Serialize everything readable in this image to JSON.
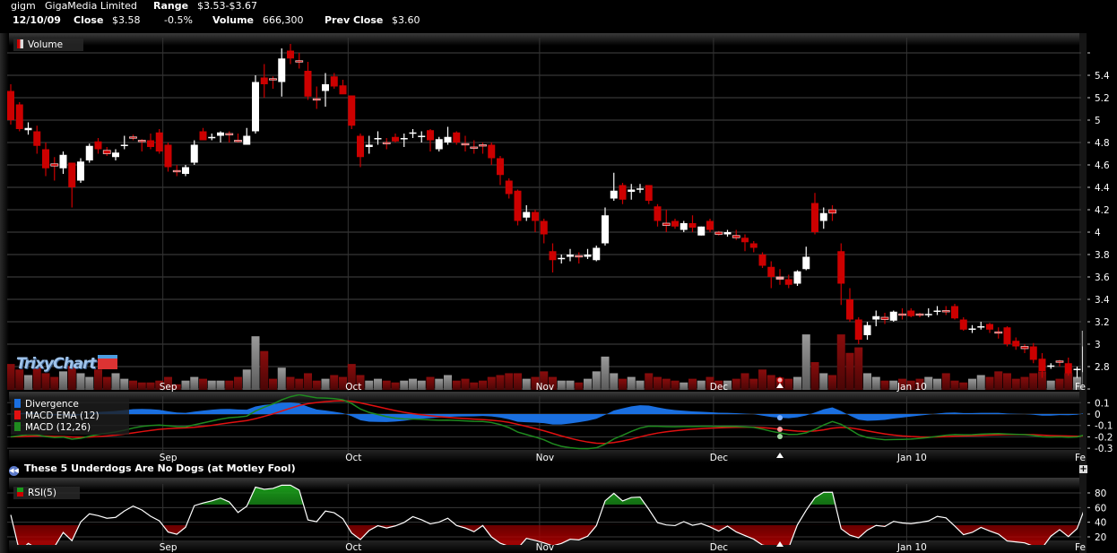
{
  "header": {
    "symbol": "gigm",
    "company": "GigaMedia Limited",
    "range_label": "Range",
    "range_value": "$3.53-$3.67",
    "date": "12/10/09",
    "close_label": "Close",
    "close_value": "$3.58",
    "change": "-0.5%",
    "volume_label": "Volume",
    "volume_value": "666,300",
    "prev_close_label": "Prev Close",
    "prev_close_value": "$3.60"
  },
  "legends": {
    "volume": "Volume",
    "divergence": "Divergence",
    "macd_ema": "MACD EMA (12)",
    "macd": "MACD (12,26)",
    "rsi": "RSI(5)"
  },
  "logo": "TrixyChart",
  "news": {
    "icon": "rewind-icon",
    "icon_glyph": "◀◀",
    "headline": "These 5 Underdogs Are No Dogs (at Motley Fool)"
  },
  "expand_button": "+",
  "colors": {
    "up": "#ffffff",
    "down": "#cc0000",
    "vol_up": "#8a8a8a",
    "vol_down": "#6e0a0a",
    "divergence": "#1a6fe0",
    "macd_ema": "#e01010",
    "macd": "#1f8a1f",
    "rsi": "#ffffff"
  },
  "chart_data": [
    {
      "type": "candlestick",
      "title": "gigm price",
      "selected_index": 88,
      "x_labels": [
        {
          "label": "Sep",
          "index": 17.4
        },
        {
          "label": "Oct",
          "index": 38.6
        },
        {
          "label": "Nov",
          "index": 60.5
        },
        {
          "label": "Dec",
          "index": 80.4
        },
        {
          "label": "Jan 10",
          "index": 102.5
        },
        {
          "label": "Fe",
          "index": 122.6
        }
      ],
      "y_ticks": [
        "2.8",
        "3",
        "3.2",
        "3.4",
        "3.6",
        "3.8",
        "4",
        "4.2",
        "4.4",
        "4.6",
        "4.8",
        "5",
        "5.2",
        "5.4"
      ],
      "ylim": [
        2.6,
        5.6
      ],
      "ohlc": [
        [
          5.26,
          5.32,
          4.96,
          5.0
        ],
        [
          5.14,
          5.16,
          4.9,
          4.92
        ],
        [
          4.91,
          4.98,
          4.87,
          4.93
        ],
        [
          4.9,
          4.95,
          4.7,
          4.77
        ],
        [
          4.74,
          4.8,
          4.5,
          4.57
        ],
        [
          4.61,
          4.67,
          4.46,
          4.59
        ],
        [
          4.57,
          4.72,
          4.52,
          4.69
        ],
        [
          4.62,
          4.62,
          4.22,
          4.4
        ],
        [
          4.46,
          4.66,
          4.44,
          4.63
        ],
        [
          4.64,
          4.79,
          4.62,
          4.77
        ],
        [
          4.81,
          4.84,
          4.7,
          4.74
        ],
        [
          4.73,
          4.76,
          4.68,
          4.7
        ],
        [
          4.67,
          4.74,
          4.64,
          4.71
        ],
        [
          4.77,
          4.86,
          4.74,
          4.78
        ],
        [
          4.85,
          4.87,
          4.82,
          4.84
        ],
        [
          4.82,
          4.83,
          4.72,
          4.81
        ],
        [
          4.82,
          4.88,
          4.74,
          4.76
        ],
        [
          4.89,
          4.92,
          4.7,
          4.72
        ],
        [
          4.78,
          4.8,
          4.54,
          4.58
        ],
        [
          4.55,
          4.6,
          4.5,
          4.54
        ],
        [
          4.52,
          4.6,
          4.5,
          4.58
        ],
        [
          4.62,
          4.82,
          4.6,
          4.78
        ],
        [
          4.9,
          4.93,
          4.82,
          4.82
        ],
        [
          4.85,
          4.88,
          4.82,
          4.85
        ],
        [
          4.86,
          4.9,
          4.8,
          4.89
        ],
        [
          4.88,
          4.9,
          4.8,
          4.87
        ],
        [
          4.82,
          4.88,
          4.8,
          4.81
        ],
        [
          4.78,
          4.93,
          4.78,
          4.86
        ],
        [
          4.9,
          5.4,
          4.88,
          5.34
        ],
        [
          5.38,
          5.5,
          5.2,
          5.32
        ],
        [
          5.37,
          5.39,
          5.28,
          5.36
        ],
        [
          5.34,
          5.64,
          5.21,
          5.55
        ],
        [
          5.62,
          5.68,
          5.5,
          5.55
        ],
        [
          5.53,
          5.6,
          5.46,
          5.52
        ],
        [
          5.44,
          5.52,
          5.18,
          5.21
        ],
        [
          5.19,
          5.3,
          5.1,
          5.18
        ],
        [
          5.26,
          5.42,
          5.12,
          5.32
        ],
        [
          5.39,
          5.42,
          5.28,
          5.3
        ],
        [
          5.31,
          5.36,
          5.25,
          5.23
        ],
        [
          5.22,
          5.22,
          4.92,
          4.95
        ],
        [
          4.86,
          4.88,
          4.58,
          4.67
        ],
        [
          4.76,
          4.86,
          4.7,
          4.78
        ],
        [
          4.83,
          4.9,
          4.78,
          4.84
        ],
        [
          4.8,
          4.84,
          4.74,
          4.79
        ],
        [
          4.85,
          4.88,
          4.8,
          4.81
        ],
        [
          4.84,
          4.88,
          4.76,
          4.84
        ],
        [
          4.88,
          4.92,
          4.84,
          4.89
        ],
        [
          4.86,
          4.9,
          4.8,
          4.86
        ],
        [
          4.91,
          4.92,
          4.72,
          4.82
        ],
        [
          4.74,
          4.85,
          4.72,
          4.83
        ],
        [
          4.8,
          4.94,
          4.78,
          4.85
        ],
        [
          4.89,
          4.9,
          4.78,
          4.8
        ],
        [
          4.79,
          4.86,
          4.72,
          4.78
        ],
        [
          4.76,
          4.82,
          4.7,
          4.75
        ],
        [
          4.78,
          4.8,
          4.7,
          4.77
        ],
        [
          4.78,
          4.8,
          4.6,
          4.66
        ],
        [
          4.66,
          4.68,
          4.42,
          4.51
        ],
        [
          4.46,
          4.48,
          4.3,
          4.34
        ],
        [
          4.37,
          4.38,
          4.06,
          4.1
        ],
        [
          4.13,
          4.24,
          4.1,
          4.18
        ],
        [
          4.18,
          4.2,
          4.0,
          4.1
        ],
        [
          4.1,
          4.12,
          3.9,
          3.98
        ],
        [
          3.83,
          3.9,
          3.64,
          3.75
        ],
        [
          3.76,
          3.8,
          3.72,
          3.77
        ],
        [
          3.78,
          3.85,
          3.74,
          3.8
        ],
        [
          3.79,
          3.82,
          3.72,
          3.78
        ],
        [
          3.78,
          3.85,
          3.76,
          3.8
        ],
        [
          3.75,
          3.88,
          3.74,
          3.86
        ],
        [
          3.9,
          4.22,
          3.88,
          4.15
        ],
        [
          4.3,
          4.53,
          4.28,
          4.37
        ],
        [
          4.42,
          4.44,
          4.25,
          4.29
        ],
        [
          4.36,
          4.43,
          4.29,
          4.38
        ],
        [
          4.38,
          4.43,
          4.35,
          4.39
        ],
        [
          4.42,
          4.42,
          4.25,
          4.28
        ],
        [
          4.23,
          4.25,
          4.05,
          4.1
        ],
        [
          4.08,
          4.2,
          4.0,
          4.06
        ],
        [
          4.1,
          4.12,
          4.03,
          4.05
        ],
        [
          4.02,
          4.1,
          4.0,
          4.08
        ],
        [
          4.08,
          4.15,
          4.0,
          4.04
        ],
        [
          3.97,
          4.05,
          3.97,
          4.05
        ],
        [
          4.1,
          4.12,
          4.0,
          4.02
        ],
        [
          4.0,
          4.01,
          3.97,
          3.98
        ],
        [
          3.98,
          4.02,
          3.96,
          4.0
        ],
        [
          3.97,
          4.02,
          3.93,
          3.95
        ],
        [
          3.95,
          3.98,
          3.83,
          3.91
        ],
        [
          3.9,
          3.92,
          3.82,
          3.86
        ],
        [
          3.8,
          3.82,
          3.68,
          3.7
        ],
        [
          3.69,
          3.74,
          3.5,
          3.6
        ],
        [
          3.6,
          3.67,
          3.53,
          3.58
        ],
        [
          3.58,
          3.62,
          3.5,
          3.53
        ],
        [
          3.54,
          3.66,
          3.52,
          3.65
        ],
        [
          3.67,
          3.87,
          3.66,
          3.78
        ],
        [
          4.26,
          4.35,
          3.98,
          4.0
        ],
        [
          4.1,
          4.22,
          4.03,
          4.17
        ],
        [
          4.2,
          4.24,
          4.1,
          4.17
        ],
        [
          3.83,
          3.9,
          3.35,
          3.54
        ],
        [
          3.4,
          3.5,
          3.2,
          3.22
        ],
        [
          3.22,
          3.24,
          3.0,
          3.04
        ],
        [
          3.08,
          3.2,
          3.04,
          3.17
        ],
        [
          3.22,
          3.3,
          3.16,
          3.25
        ],
        [
          3.24,
          3.28,
          3.18,
          3.22
        ],
        [
          3.21,
          3.3,
          3.2,
          3.29
        ],
        [
          3.27,
          3.32,
          3.22,
          3.26
        ],
        [
          3.3,
          3.32,
          3.24,
          3.25
        ],
        [
          3.27,
          3.28,
          3.24,
          3.26
        ],
        [
          3.26,
          3.32,
          3.24,
          3.27
        ],
        [
          3.29,
          3.34,
          3.26,
          3.3
        ],
        [
          3.3,
          3.34,
          3.26,
          3.29
        ],
        [
          3.34,
          3.36,
          3.22,
          3.23
        ],
        [
          3.22,
          3.24,
          3.12,
          3.13
        ],
        [
          3.13,
          3.17,
          3.1,
          3.14
        ],
        [
          3.15,
          3.2,
          3.13,
          3.16
        ],
        [
          3.18,
          3.19,
          3.1,
          3.13
        ],
        [
          3.11,
          3.15,
          3.05,
          3.1
        ],
        [
          3.15,
          3.16,
          2.98,
          3.0
        ],
        [
          3.03,
          3.06,
          2.95,
          2.98
        ],
        [
          2.98,
          3.0,
          2.92,
          2.96
        ],
        [
          2.98,
          3.01,
          2.83,
          2.86
        ],
        [
          2.87,
          2.92,
          2.7,
          2.76
        ],
        [
          2.8,
          2.83,
          2.78,
          2.81
        ],
        [
          2.85,
          2.86,
          2.8,
          2.84
        ],
        [
          2.83,
          2.88,
          2.72,
          2.74
        ],
        [
          2.77,
          2.8,
          2.7,
          2.78
        ],
        [
          2.75,
          3.02,
          2.74,
          2.98
        ]
      ],
      "volume_thousands": [
        1400,
        1100,
        800,
        1200,
        900,
        700,
        1000,
        1300,
        900,
        700,
        1100,
        700,
        900,
        600,
        500,
        400,
        400,
        500,
        700,
        300,
        500,
        700,
        600,
        500,
        500,
        500,
        700,
        1100,
        2900,
        2100,
        600,
        1200,
        700,
        600,
        900,
        500,
        600,
        800,
        700,
        1400,
        800,
        500,
        600,
        500,
        400,
        500,
        600,
        500,
        700,
        600,
        800,
        500,
        600,
        400,
        500,
        700,
        800,
        900,
        900,
        600,
        700,
        1000,
        700,
        500,
        500,
        400,
        600,
        1000,
        1800,
        900,
        600,
        700,
        500,
        900,
        700,
        600,
        500,
        400,
        600,
        500,
        700,
        500,
        500,
        600,
        900,
        600,
        1100,
        800,
        666,
        600,
        700,
        3000,
        1500,
        900,
        800,
        3000,
        2000,
        2300,
        900,
        700,
        500,
        500,
        600,
        500,
        600,
        700,
        600,
        900,
        500,
        400,
        600,
        800,
        700,
        1000,
        900,
        600,
        700,
        900,
        1000,
        500,
        600,
        900,
        700,
        3200
      ]
    },
    {
      "type": "line",
      "title": "MACD",
      "series": [
        "Divergence",
        "MACD EMA (12)",
        "MACD (12,26)"
      ],
      "y_ticks": [
        "0.1",
        "0",
        "-0.1",
        "-0.2",
        "-0.3"
      ],
      "ylim": [
        -0.35,
        0.17
      ]
    },
    {
      "type": "line",
      "title": "RSI(5)",
      "y_ticks": [
        "20",
        "40",
        "60",
        "80"
      ],
      "ylim": [
        8,
        92
      ]
    }
  ]
}
